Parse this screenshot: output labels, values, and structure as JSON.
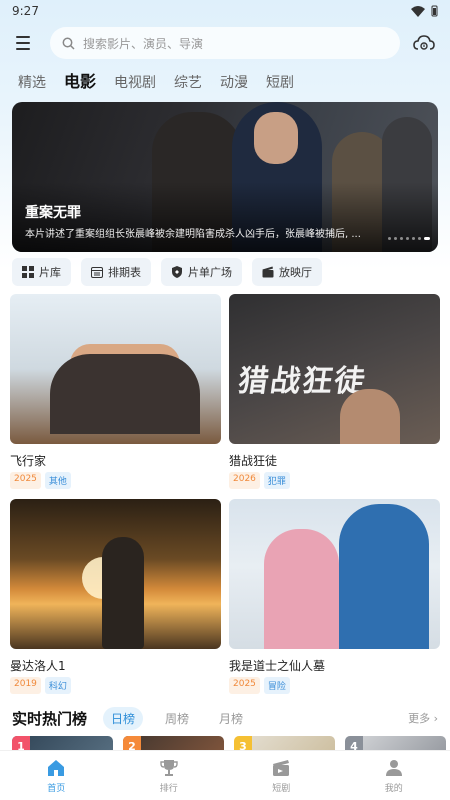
{
  "status": {
    "time": "9:27"
  },
  "search": {
    "placeholder": "搜索影片、演员、导演"
  },
  "tabs": [
    {
      "label": "精选",
      "active": false
    },
    {
      "label": "电影",
      "active": true
    },
    {
      "label": "电视剧",
      "active": false
    },
    {
      "label": "综艺",
      "active": false
    },
    {
      "label": "动漫",
      "active": false
    },
    {
      "label": "短剧",
      "active": false
    }
  ],
  "banner": {
    "title": "重案无罪",
    "description": "本片讲述了重案组组长张晨峰被余建明陷害成杀人凶手后，张晨峰被捕后, ..."
  },
  "quick_actions": [
    {
      "label": "片库",
      "icon": "grid-icon"
    },
    {
      "label": "排期表",
      "icon": "calendar-icon"
    },
    {
      "label": "片单广场",
      "icon": "shield-list-icon"
    },
    {
      "label": "放映厅",
      "icon": "clapper-icon"
    }
  ],
  "movies": [
    {
      "title": "飞行家",
      "year": "2025",
      "genre": "其他",
      "poster_text": ""
    },
    {
      "title": "猎战狂徒",
      "year": "2026",
      "genre": "犯罪",
      "poster_text": "猎战狂徒"
    },
    {
      "title": "曼达洛人1",
      "year": "2019",
      "genre": "科幻",
      "poster_text": ""
    },
    {
      "title": "我是道士之仙人墓",
      "year": "2025",
      "genre": "冒险",
      "poster_text": ""
    }
  ],
  "hot": {
    "title": "实时热门榜",
    "tabs": [
      {
        "label": "日榜",
        "active": true
      },
      {
        "label": "周榜",
        "active": false
      },
      {
        "label": "月榜",
        "active": false
      }
    ],
    "more": "更多 ›",
    "items": [
      {
        "rank": "1"
      },
      {
        "rank": "2"
      },
      {
        "rank": "3"
      },
      {
        "rank": "4"
      }
    ]
  },
  "nav": [
    {
      "label": "首页",
      "icon": "home-icon",
      "active": true
    },
    {
      "label": "排行",
      "icon": "trophy-icon",
      "active": false
    },
    {
      "label": "短剧",
      "icon": "clapperboard-icon",
      "active": false
    },
    {
      "label": "我的",
      "icon": "user-icon",
      "active": false
    }
  ],
  "colors": {
    "accent": "#3a9be2",
    "year_tag": "#f08a3c",
    "genre_tag": "#3a8ed8"
  }
}
